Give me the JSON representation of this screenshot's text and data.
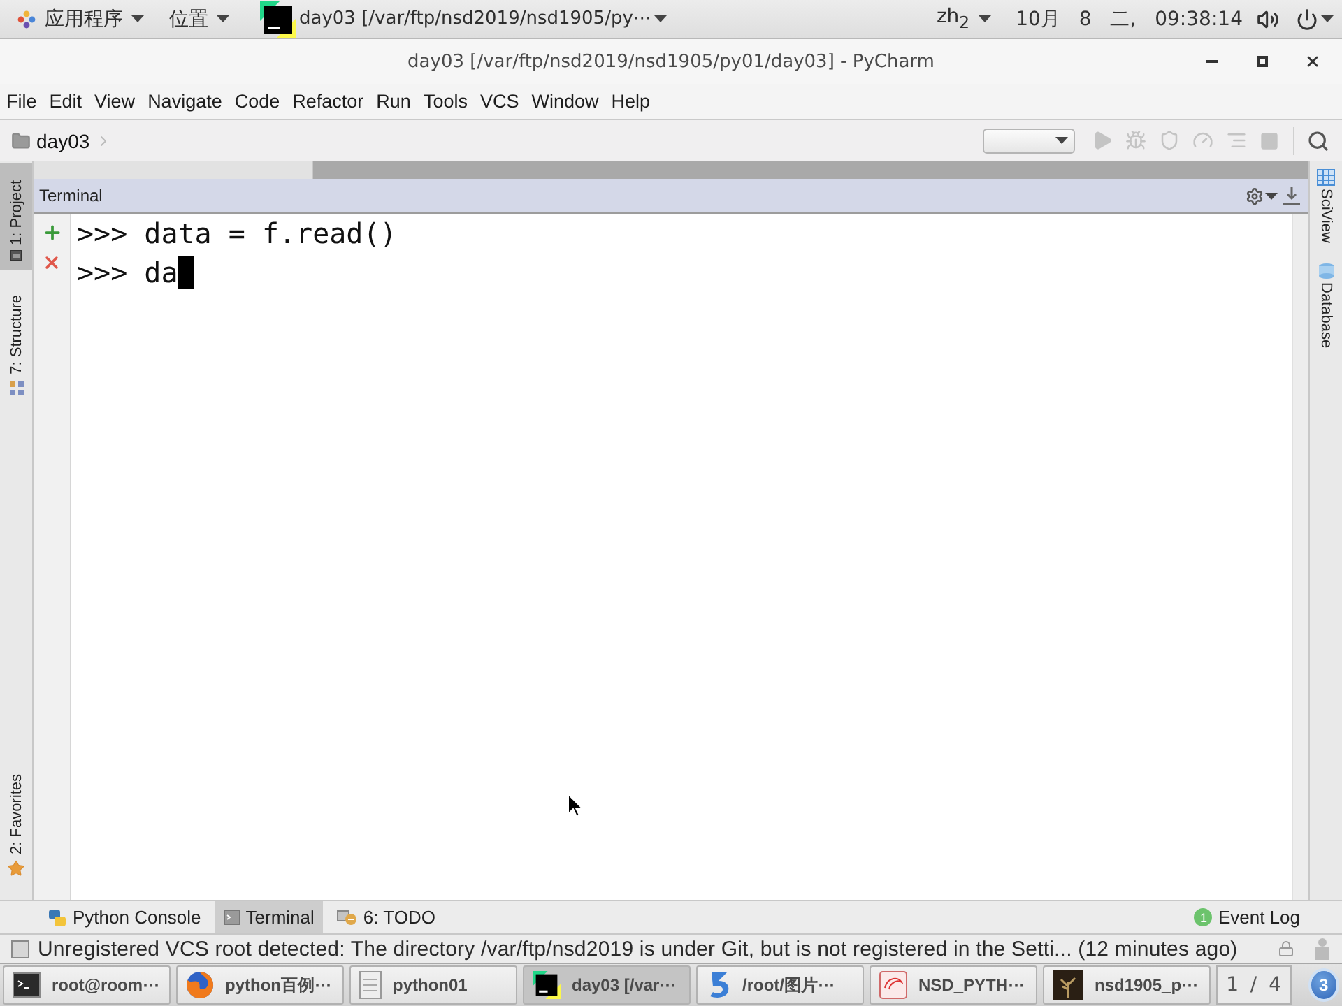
{
  "top_panel": {
    "applications_menu": "应用程序",
    "places_menu": "位置",
    "active_window": "day03 [/var/ftp/nsd2019/nsd1905/py⋯",
    "input_method": "zh$_{2}$",
    "clock": "10月 8 二, 09:38:14"
  },
  "window": {
    "title": "day03 [/var/ftp/nsd2019/nsd1905/py01/day03] - PyCharm"
  },
  "menu": [
    "File",
    "Edit",
    "View",
    "Navigate",
    "Code",
    "Refactor",
    "Run",
    "Tools",
    "VCS",
    "Window",
    "Help"
  ],
  "breadcrumb": "day03",
  "left_tool_tabs": [
    {
      "label": "1: Project",
      "selected": true,
      "kind": "project"
    },
    {
      "label": "7: Structure",
      "selected": false,
      "kind": "structure"
    },
    {
      "label": "2: Favorites",
      "selected": false,
      "kind": "favorites"
    }
  ],
  "terminal": {
    "title": "Terminal",
    "lines": [
      {
        "text": ">>> data = f.read()",
        "cursor": false
      },
      {
        "text": ">>> da",
        "cursor": true
      }
    ]
  },
  "right_tool_tabs": [
    {
      "label": "SciView",
      "kind": "sciview"
    },
    {
      "label": "Database",
      "kind": "database"
    }
  ],
  "bottom_tool_tabs": [
    {
      "label": "Python Console",
      "selected": false,
      "kind": "python"
    },
    {
      "label": "Terminal",
      "selected": true,
      "kind": "terminal"
    },
    {
      "label": "6: TODO",
      "selected": false,
      "kind": "todo"
    }
  ],
  "event_log": {
    "label": "Event Log",
    "count": "1"
  },
  "status_bar": {
    "message": "Unregistered VCS root detected: The directory /var/ftp/nsd2019 is under Git, but is not registered in the Setti... (12 minutes ago)"
  },
  "taskbar": {
    "items": [
      {
        "label": "root@room⋯",
        "kind": "terminal",
        "selected": false
      },
      {
        "label": "python百例⋯",
        "kind": "browser",
        "selected": false
      },
      {
        "label": "python01",
        "kind": "files",
        "selected": false
      },
      {
        "label": "day03 [/var⋯",
        "kind": "pycharm",
        "selected": true
      },
      {
        "label": "/root/图片⋯",
        "kind": "viewer",
        "selected": false
      },
      {
        "label": "NSD_PYTH⋯",
        "kind": "document",
        "selected": false
      },
      {
        "label": "nsd1905_p⋯",
        "kind": "thumbnail",
        "selected": false
      }
    ],
    "pager": "1 / 4",
    "workspace": "3"
  }
}
